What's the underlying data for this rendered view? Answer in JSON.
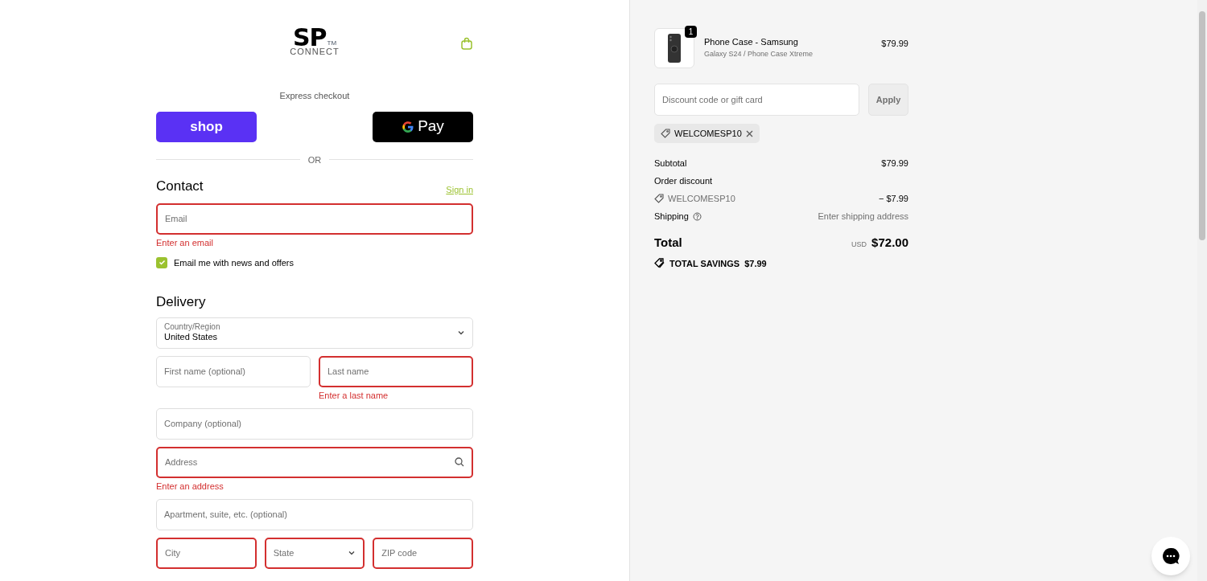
{
  "logo": {
    "mark": "SP",
    "trademark": "TM",
    "wordmark": "CONNECT"
  },
  "express_checkout": {
    "title": "Express checkout",
    "buttons": [
      {
        "kind": "shop",
        "label": "shop"
      },
      {
        "kind": "gpay",
        "label": "Pay"
      }
    ],
    "divider": "OR"
  },
  "contact": {
    "heading": "Contact",
    "sign_in": "Sign in",
    "email": {
      "placeholder": "Email",
      "invalid": true,
      "error": "Enter an email"
    },
    "newsletter": {
      "label": "Email me with news and offers",
      "checked": true
    }
  },
  "delivery": {
    "heading": "Delivery",
    "rows": [
      [
        {
          "kind": "select",
          "label": "Country/Region",
          "value": "United States",
          "invalid": false
        }
      ],
      [
        {
          "kind": "text",
          "placeholder": "First name (optional)",
          "invalid": false
        },
        {
          "kind": "text",
          "placeholder": "Last name",
          "invalid": true,
          "error": "Enter a last name"
        }
      ],
      [
        {
          "kind": "text",
          "placeholder": "Company (optional)",
          "invalid": false
        }
      ],
      [
        {
          "kind": "search",
          "placeholder": "Address",
          "invalid": true,
          "error": "Enter an address"
        }
      ],
      [
        {
          "kind": "text",
          "placeholder": "Apartment, suite, etc. (optional)",
          "invalid": false
        }
      ],
      [
        {
          "kind": "text",
          "placeholder": "City",
          "invalid": true
        },
        {
          "kind": "select",
          "placeholder": "State",
          "invalid": true
        },
        {
          "kind": "text",
          "placeholder": "ZIP code",
          "invalid": true
        }
      ]
    ]
  },
  "summary": {
    "items": [
      {
        "name": "Phone Case - Samsung",
        "variant": "Galaxy S24 / Phone Case Xtreme",
        "quantity": "1",
        "price": "$79.99"
      }
    ],
    "discount": {
      "placeholder": "Discount code or gift card",
      "apply": "Apply",
      "applied_codes": [
        "WELCOMESP10"
      ]
    },
    "lines": [
      {
        "kind": "plain",
        "label": "Subtotal",
        "value": "$79.99"
      },
      {
        "kind": "heading",
        "label": "Order discount"
      },
      {
        "kind": "code",
        "label": "WELCOMESP10",
        "value": "− $7.99"
      },
      {
        "kind": "help",
        "label": "Shipping",
        "value": "Enter shipping address"
      }
    ],
    "total": {
      "label": "Total",
      "currency": "USD",
      "amount": "$72.00"
    },
    "savings": {
      "label": "TOTAL SAVINGS",
      "amount": "$7.99"
    }
  }
}
